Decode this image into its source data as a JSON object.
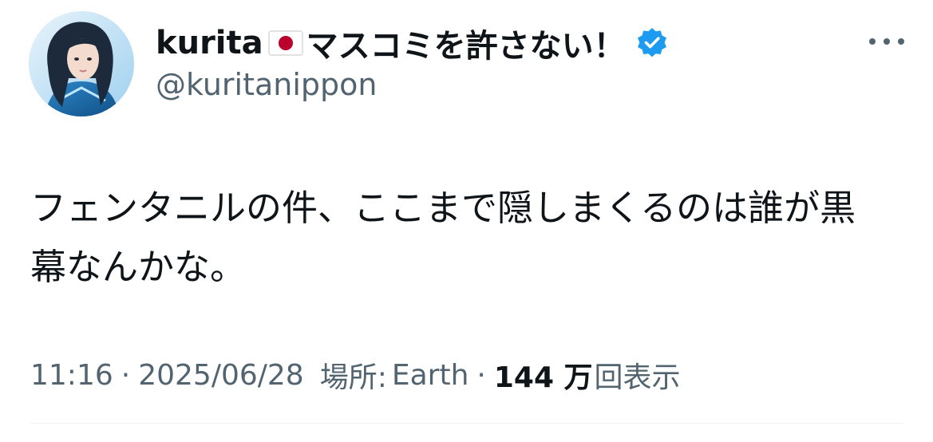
{
  "tweet": {
    "author": {
      "display_name": "kurita",
      "flag_icon": "japan-flag-icon",
      "name_suffix": "マスコミを許さない！",
      "verified_icon": "verified-badge-icon",
      "handle": "@kuritanippon"
    },
    "more_icon": "more-options-icon",
    "text_line1": "フェンタニルの件、ここまで隠しまくるのは誰が黒",
    "text_line2": "幕なんかな。",
    "meta": {
      "time": "11:16",
      "separator": "·",
      "date": "2025/06/28",
      "location_label": "場所:",
      "location": "Earth",
      "views_count": "144 万",
      "views_label": "回表示"
    }
  },
  "colors": {
    "text_primary": "#0f1419",
    "text_secondary": "#536471",
    "verified_blue": "#1d9bf0",
    "divider": "#eff3f4"
  }
}
